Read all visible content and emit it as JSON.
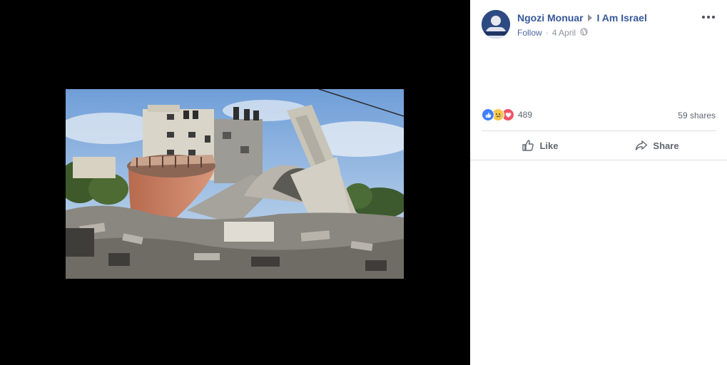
{
  "post": {
    "author_name": "Ngozi Monuar",
    "page_name": "I Am Israel",
    "follow_label": "Follow",
    "separator": "·",
    "date": "4 April",
    "privacy_icon": "globe-icon",
    "more_icon": "more-options-icon"
  },
  "reactions": {
    "icons": [
      "like-reaction-icon",
      "sad-reaction-icon",
      "love-reaction-icon"
    ],
    "count": "489",
    "shares": "59 shares"
  },
  "actions": {
    "like_label": "Like",
    "share_label": "Share"
  },
  "colors": {
    "viewer_background": "#000000",
    "link_blue": "#365899",
    "meta_gray": "#90949c",
    "action_gray": "#606770",
    "like_blue": "#4080ff",
    "love_red": "#f25268",
    "sad_yellow": "#f7c74b"
  }
}
